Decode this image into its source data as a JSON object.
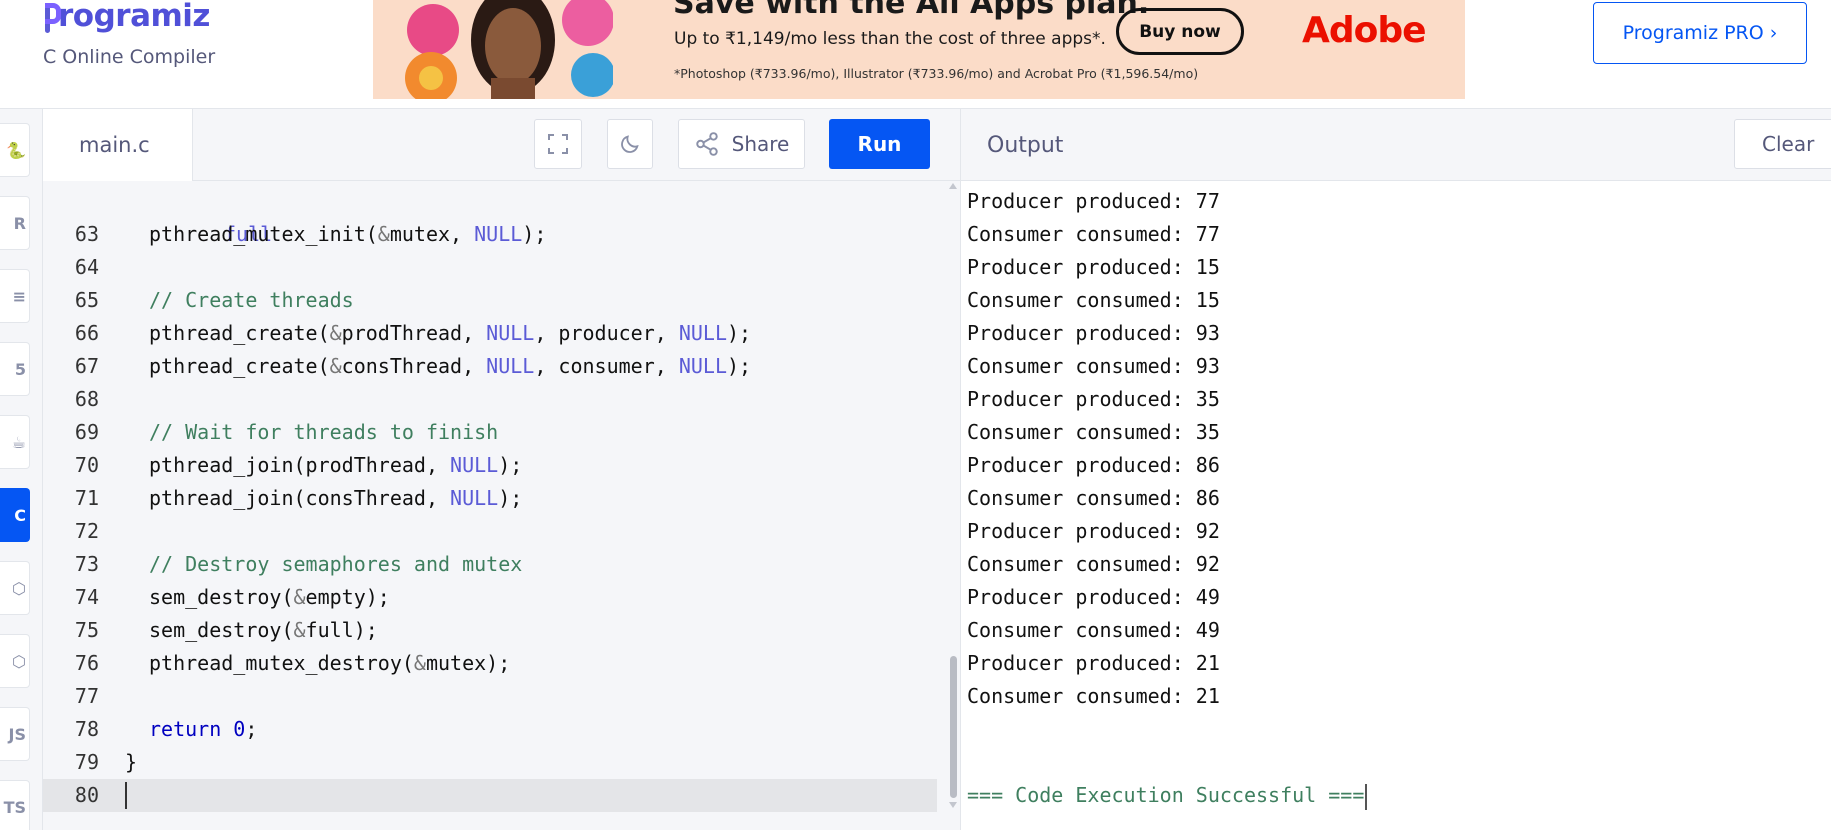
{
  "header": {
    "logo_text": "rogramiz",
    "subtitle": "C Online Compiler",
    "pro_button": "Programiz PRO ›"
  },
  "ad": {
    "headline": "Save with the All Apps plan.",
    "line2": "Up to ₹1,149/mo less than the cost of three apps*.",
    "line3": "*Photoshop (₹733.96/mo), Illustrator (₹733.96/mo) and Acrobat Pro (₹1,596.54/mo)",
    "button": "Buy now",
    "brand": "Adobe"
  },
  "rail": {
    "items": [
      {
        "name": "python",
        "glyph": "🐍",
        "active": false
      },
      {
        "name": "r",
        "glyph": "R",
        "active": false
      },
      {
        "name": "sql",
        "glyph": "≡",
        "active": false
      },
      {
        "name": "html",
        "glyph": "5",
        "active": false
      },
      {
        "name": "java",
        "glyph": "☕",
        "active": false
      },
      {
        "name": "c",
        "glyph": "C",
        "active": true
      },
      {
        "name": "cpp",
        "glyph": "⬡",
        "active": false
      },
      {
        "name": "csharp",
        "glyph": "⬡",
        "active": false
      },
      {
        "name": "javascript",
        "glyph": "JS",
        "active": false
      },
      {
        "name": "typescript",
        "glyph": "TS",
        "active": false
      }
    ]
  },
  "editor": {
    "file_name": "main.c",
    "share_label": "Share",
    "run_label": "Run",
    "wrapped_continuation": "full",
    "lines": [
      {
        "n": "63",
        "code": "    pthread_mutex_init(&mutex, NULL);"
      },
      {
        "n": "64",
        "code": ""
      },
      {
        "n": "65",
        "code": "    // Create threads"
      },
      {
        "n": "66",
        "code": "    pthread_create(&prodThread, NULL, producer, NULL);"
      },
      {
        "n": "67",
        "code": "    pthread_create(&consThread, NULL, consumer, NULL);"
      },
      {
        "n": "68",
        "code": ""
      },
      {
        "n": "69",
        "code": "    // Wait for threads to finish"
      },
      {
        "n": "70",
        "code": "    pthread_join(prodThread, NULL);"
      },
      {
        "n": "71",
        "code": "    pthread_join(consThread, NULL);"
      },
      {
        "n": "72",
        "code": ""
      },
      {
        "n": "73",
        "code": "    // Destroy semaphores and mutex"
      },
      {
        "n": "74",
        "code": "    sem_destroy(&empty);"
      },
      {
        "n": "75",
        "code": "    sem_destroy(&full);"
      },
      {
        "n": "76",
        "code": "    pthread_mutex_destroy(&mutex);"
      },
      {
        "n": "77",
        "code": ""
      },
      {
        "n": "78",
        "code": "    return 0;"
      },
      {
        "n": "79",
        "code": "}"
      },
      {
        "n": "80",
        "code": ""
      }
    ]
  },
  "output": {
    "title": "Output",
    "clear_label": "Clear",
    "lines": [
      "Producer produced: 77",
      "Consumer consumed: 77",
      "Producer produced: 15",
      "Consumer consumed: 15",
      "Producer produced: 93",
      "Consumer consumed: 93",
      "Producer produced: 35",
      "Consumer consumed: 35",
      "Producer produced: 86",
      "Consumer consumed: 86",
      "Producer produced: 92",
      "Consumer consumed: 92",
      "Producer produced: 49",
      "Consumer consumed: 49",
      "Producer produced: 21",
      "Consumer consumed: 21"
    ],
    "success": "=== Code Execution Successful ==="
  },
  "colors": {
    "accent": "#0556f3",
    "brand": "#5050d8",
    "comment": "#3f7f5f",
    "null_keyword": "#5b5bd6",
    "return_keyword": "#0000c0",
    "adobe": "#eb1000"
  }
}
